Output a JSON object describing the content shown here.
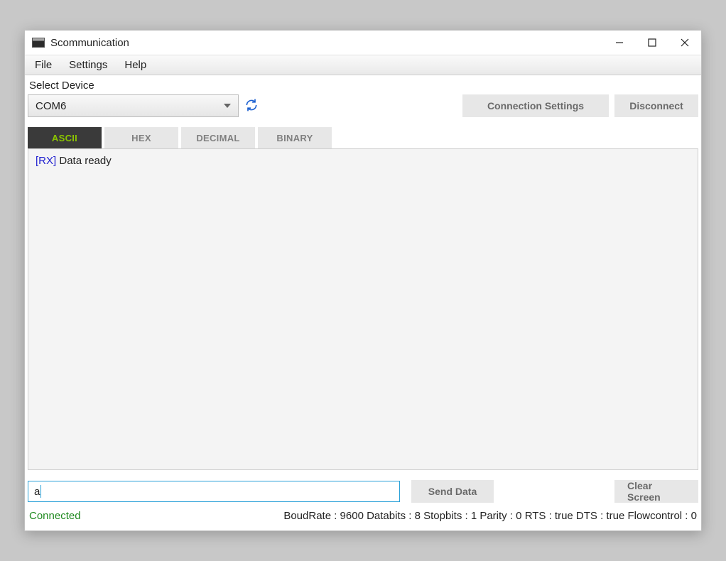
{
  "titlebar": {
    "app_name": "Scommunication"
  },
  "menubar": {
    "items": [
      {
        "label": "File"
      },
      {
        "label": "Settings"
      },
      {
        "label": "Help"
      }
    ]
  },
  "device": {
    "label": "Select Device",
    "selected": "COM6"
  },
  "buttons": {
    "connection_settings": "Connection Settings",
    "disconnect": "Disconnect",
    "send_data": "Send Data",
    "clear_screen": "Clear Screen"
  },
  "tabs": [
    {
      "label": "ASCII",
      "active": true
    },
    {
      "label": "HEX",
      "active": false
    },
    {
      "label": "DECIMAL",
      "active": false
    },
    {
      "label": "BINARY",
      "active": false
    }
  ],
  "console": {
    "lines": [
      {
        "tag": "[RX]",
        "text": " Data ready"
      }
    ]
  },
  "input": {
    "value": "a"
  },
  "status": {
    "connection": "Connected",
    "settings": "BoudRate : 9600 Databits : 8 Stopbits : 1 Parity : 0 RTS : true DTS : true Flowcontrol : 0"
  }
}
